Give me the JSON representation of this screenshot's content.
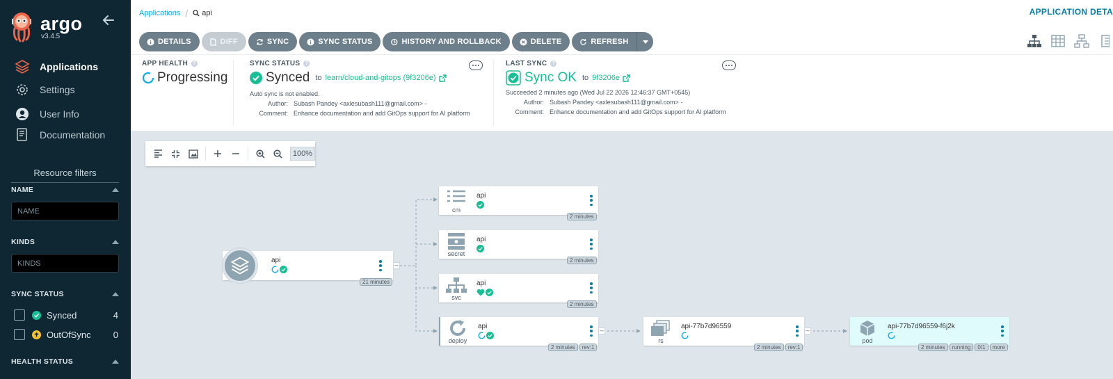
{
  "sidebar": {
    "brand": "argo",
    "version": "v3.4.5",
    "nav": [
      {
        "label": "Applications",
        "icon": "stack-icon"
      },
      {
        "label": "Settings",
        "icon": "gear-icon"
      },
      {
        "label": "User Info",
        "icon": "user-icon"
      },
      {
        "label": "Documentation",
        "icon": "book-icon"
      }
    ],
    "filters_title": "Resource filters",
    "name_head": "NAME",
    "name_placeholder": "NAME",
    "kinds_head": "KINDS",
    "kinds_placeholder": "KINDS",
    "sync_head": "SYNC STATUS",
    "sync_items": [
      {
        "label": "Synced",
        "count": "4"
      },
      {
        "label": "OutOfSync",
        "count": "0"
      }
    ],
    "health_head": "HEALTH STATUS"
  },
  "header": {
    "breadcrumb_root": "Applications",
    "breadcrumb_current": "api",
    "title": "APPLICATION DETA",
    "buttons": {
      "details": "DETAILS",
      "diff": "DIFF",
      "sync": "SYNC",
      "sync_status": "SYNC STATUS",
      "history": "HISTORY AND ROLLBACK",
      "delete": "DELETE",
      "refresh": "REFRESH"
    }
  },
  "app_health": {
    "label": "APP HEALTH",
    "status": "Progressing"
  },
  "sync_status": {
    "label": "SYNC STATUS",
    "status": "Synced",
    "to": "to",
    "target": "learn/cloud-and-gitops (9f3206e)",
    "auto_sync": "Auto sync is not enabled.",
    "author_k": "Author:",
    "author_v": "Subash Pandey <axlesubash111@gmail.com> -",
    "comment_k": "Comment:",
    "comment_v": "Enhance documentation and add GitOps support for AI platform"
  },
  "last_sync": {
    "label": "LAST SYNC",
    "status": "Sync OK",
    "to": "to",
    "target": "9f3206e",
    "succeeded": "Succeeded 2 minutes ago (Wed Jul 22 2026 12:46:37 GMT+0545)",
    "author_k": "Author:",
    "author_v": "Subash Pandey <axlesubash111@gmail.com> -",
    "comment_k": "Comment:",
    "comment_v": "Enhance documentation and add GitOps support for AI platform"
  },
  "graph": {
    "zoom": "100%",
    "app_node": {
      "name": "api",
      "age": "21 minutes"
    },
    "nodes": [
      {
        "name": "api",
        "kind": "cm",
        "tags": [
          "2 minutes"
        ]
      },
      {
        "name": "api",
        "kind": "secret",
        "tags": [
          "2 minutes"
        ]
      },
      {
        "name": "api",
        "kind": "svc",
        "tags": [
          "2 minutes"
        ]
      },
      {
        "name": "api",
        "kind": "deploy",
        "tags": [
          "2 minutes",
          "rev:1"
        ]
      },
      {
        "name": "api-77b7d96559",
        "kind": "rs",
        "tags": [
          "2 minutes",
          "rev:1"
        ]
      },
      {
        "name": "api-77b7d96559-f6j2k",
        "kind": "pod",
        "tags": [
          "2 minutes",
          "running",
          "0/1",
          "more"
        ]
      }
    ]
  },
  "colors": {
    "sidebar_bg": "#0e2733",
    "synced": "#18be94",
    "progressing": "#0dadea",
    "out_of_sync": "#f4c030",
    "button": "#6d7f8b"
  }
}
